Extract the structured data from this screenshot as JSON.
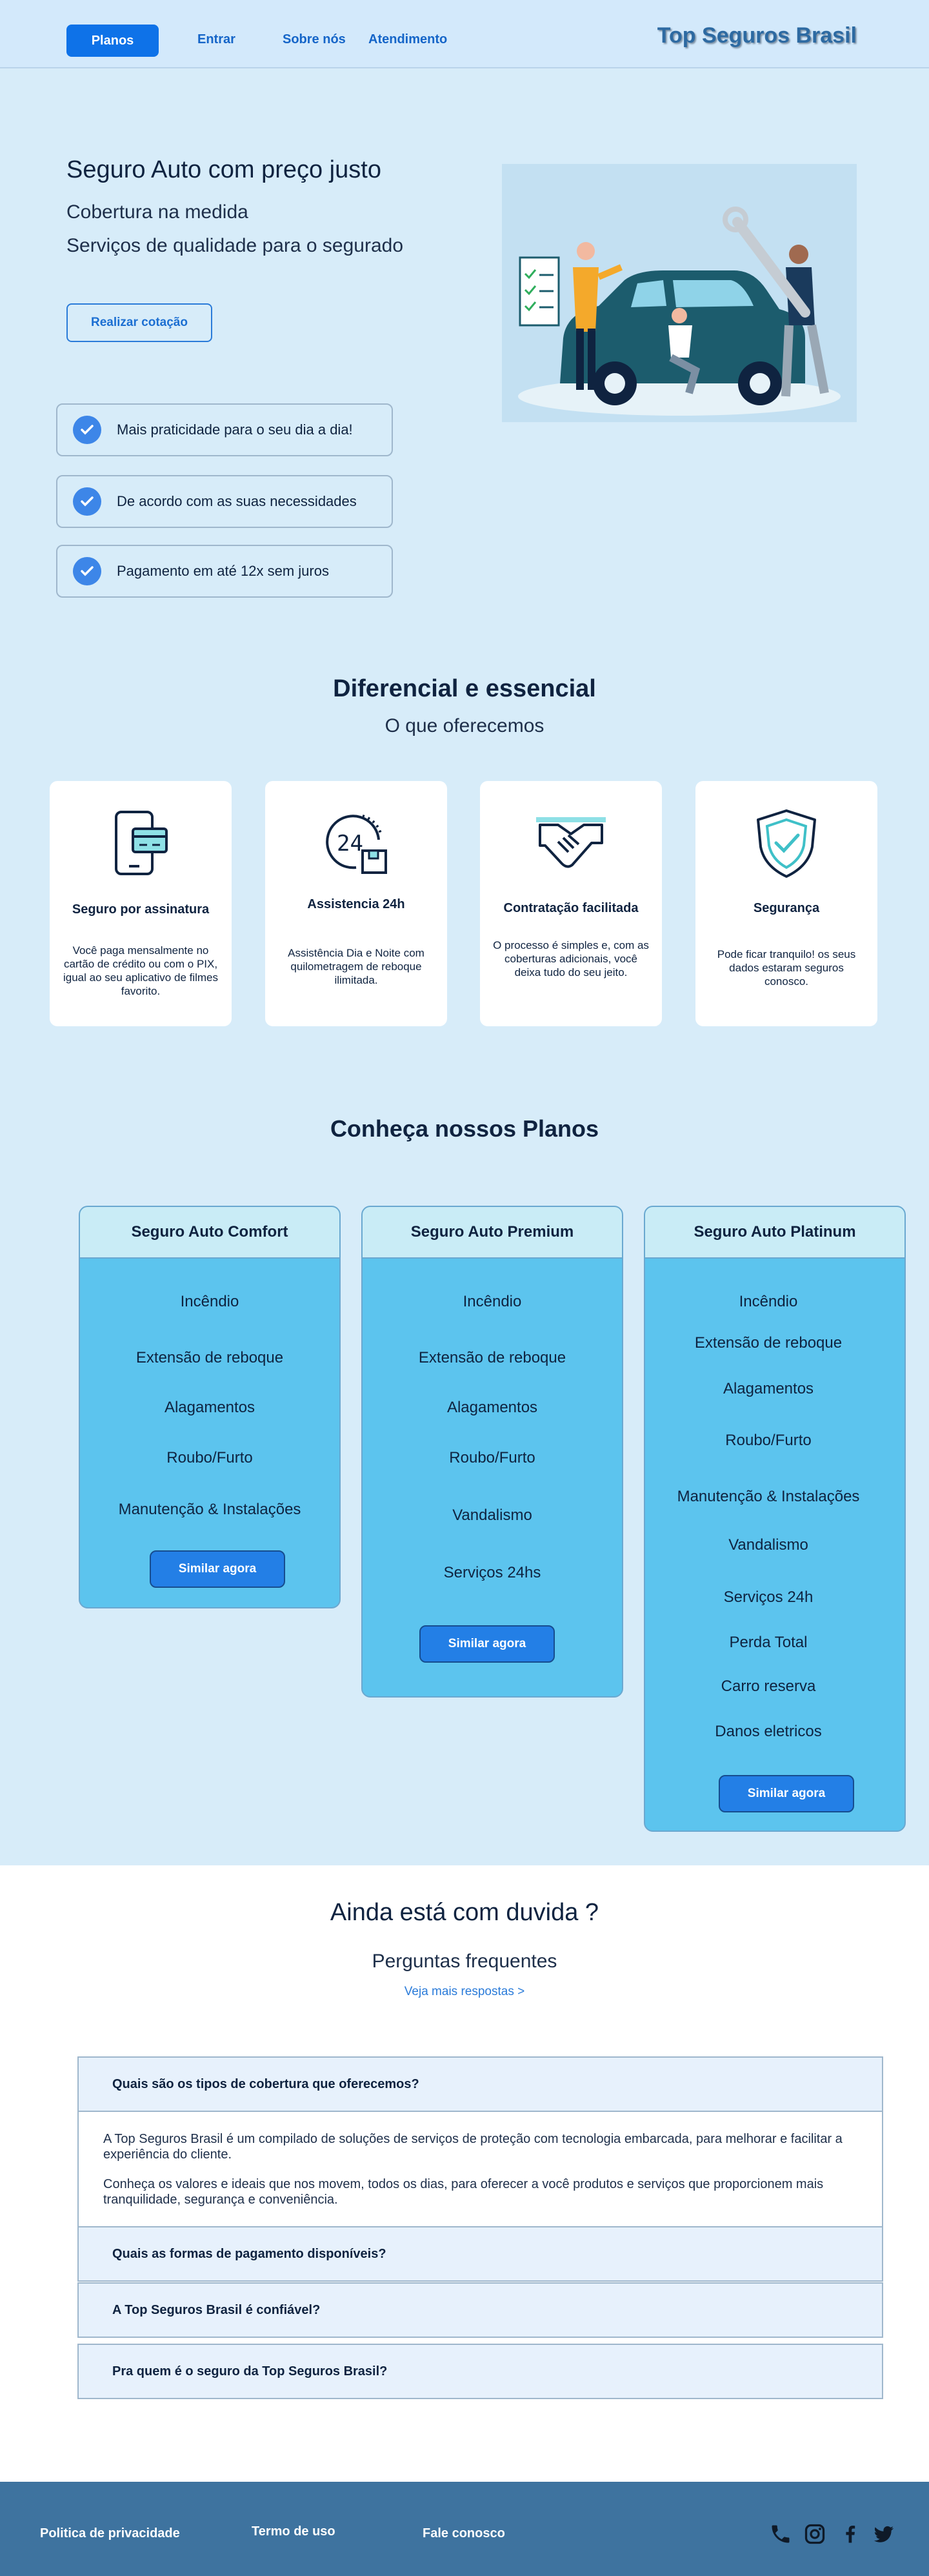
{
  "header": {
    "nav": {
      "planos": "Planos",
      "entrar": "Entrar",
      "sobre": "Sobre nós",
      "atendimento": "Atendimento"
    },
    "brand": "Top Seguros Brasil"
  },
  "hero": {
    "title": "Seguro Auto com preço justo",
    "subtitle_1": "Cobertura na medida",
    "subtitle_2": "Serviços de qualidade para o segurado",
    "cta": "Realizar cotação",
    "benefits": [
      "Mais praticidade para o seu dia a dia!",
      "De acordo com as suas necessidades",
      "Pagamento em até 12x sem juros"
    ]
  },
  "features": {
    "title": "Diferencial e essencial",
    "subtitle": "O que oferecemos",
    "cards": [
      {
        "title": "Seguro por assinatura",
        "desc": "Você paga mensalmente no cartão de crédito ou com o PIX, igual ao seu aplicativo de filmes favorito.",
        "icon": "phone-card-icon"
      },
      {
        "title": "Assistencia 24h",
        "desc": "Assistência Dia e Noite com quilometragem de reboque ilimitada.",
        "icon": "clock-24h-icon"
      },
      {
        "title": "Contratação facilitada",
        "desc": "O processo é simples e, com as coberturas adicionais, você deixa tudo do seu jeito.",
        "icon": "handshake-icon"
      },
      {
        "title": "Segurança",
        "desc": "Pode ficar tranquilo! os seus dados estaram seguros conosco.",
        "icon": "shield-check-icon"
      }
    ]
  },
  "plans": {
    "title": "Conheça nossos Planos",
    "cta": "Similar agora",
    "items": [
      {
        "name": "Seguro Auto Comfort",
        "coverages": [
          "Incêndio",
          "Extensão de reboque",
          "Alagamentos",
          "Roubo/Furto",
          "Manutenção & Instalações"
        ]
      },
      {
        "name": "Seguro Auto Premium",
        "coverages": [
          "Incêndio",
          "Extensão de reboque",
          "Alagamentos",
          "Roubo/Furto",
          "Vandalismo",
          "Serviços 24hs"
        ]
      },
      {
        "name": "Seguro Auto Platinum",
        "coverages": [
          "Incêndio",
          "Extensão de reboque",
          "Alagamentos",
          "Roubo/Furto",
          "Manutenção & Instalações",
          "Vandalismo",
          "Serviços 24h",
          "Perda Total",
          "Carro reserva",
          "Danos eletricos"
        ]
      }
    ]
  },
  "faq": {
    "title": "Ainda está com duvida ?",
    "subtitle": "Perguntas frequentes",
    "more": "Veja mais respostas   >",
    "questions": [
      "Quais são os tipos de cobertura que oferecemos?",
      "Quais as formas de pagamento disponíveis?",
      "A Top Seguros Brasil é confiável?",
      "Pra quem é o seguro da Top Seguros Brasil?"
    ],
    "answer_1": "A Top Seguros Brasil é um compilado de soluções de serviços de proteção com tecnologia embarcada, para melhorar e facilitar a experiência do cliente.",
    "answer_2": "Conheça os valores e ideais que nos movem, todos os dias, para oferecer a você produtos e serviços que proporcionem mais tranquilidade, segurança e conveniência."
  },
  "footer": {
    "privacy": "Politica de privacidade",
    "terms": "Termo de uso",
    "contact": "Fale conosco",
    "social_icons": [
      "phone-icon",
      "instagram-icon",
      "facebook-icon",
      "twitter-icon"
    ]
  },
  "colors": {
    "primary": "#0e72e8",
    "page_bg": "#d7ecf9",
    "plan_bg": "#5cc4ee",
    "footer_bg": "#3e739f"
  }
}
